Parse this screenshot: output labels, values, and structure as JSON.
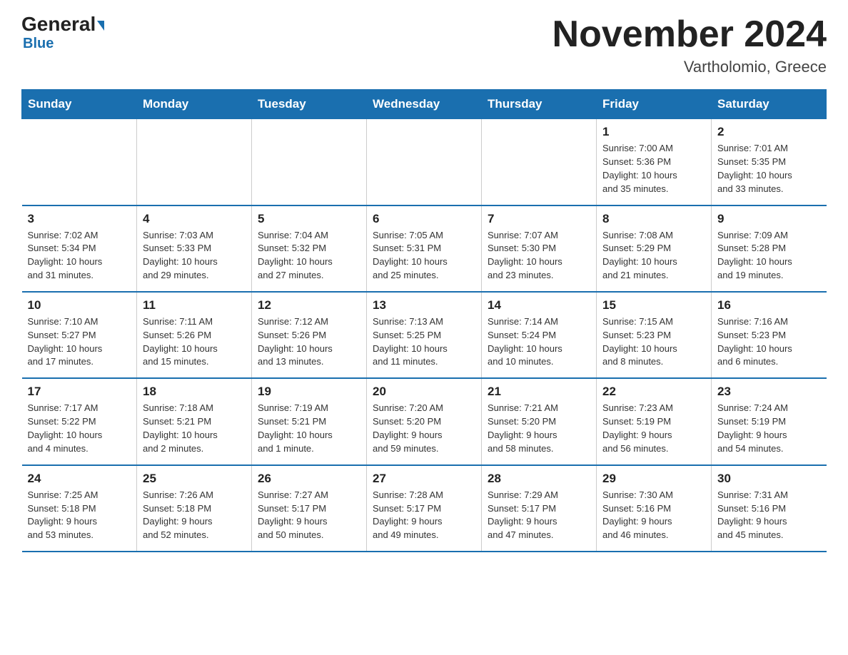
{
  "header": {
    "logo_line1a": "General",
    "logo_line1b": "Blue",
    "month_title": "November 2024",
    "subtitle": "Vartholomio, Greece"
  },
  "weekdays": [
    "Sunday",
    "Monday",
    "Tuesday",
    "Wednesday",
    "Thursday",
    "Friday",
    "Saturday"
  ],
  "rows": [
    [
      {
        "day": "",
        "info": ""
      },
      {
        "day": "",
        "info": ""
      },
      {
        "day": "",
        "info": ""
      },
      {
        "day": "",
        "info": ""
      },
      {
        "day": "",
        "info": ""
      },
      {
        "day": "1",
        "info": "Sunrise: 7:00 AM\nSunset: 5:36 PM\nDaylight: 10 hours\nand 35 minutes."
      },
      {
        "day": "2",
        "info": "Sunrise: 7:01 AM\nSunset: 5:35 PM\nDaylight: 10 hours\nand 33 minutes."
      }
    ],
    [
      {
        "day": "3",
        "info": "Sunrise: 7:02 AM\nSunset: 5:34 PM\nDaylight: 10 hours\nand 31 minutes."
      },
      {
        "day": "4",
        "info": "Sunrise: 7:03 AM\nSunset: 5:33 PM\nDaylight: 10 hours\nand 29 minutes."
      },
      {
        "day": "5",
        "info": "Sunrise: 7:04 AM\nSunset: 5:32 PM\nDaylight: 10 hours\nand 27 minutes."
      },
      {
        "day": "6",
        "info": "Sunrise: 7:05 AM\nSunset: 5:31 PM\nDaylight: 10 hours\nand 25 minutes."
      },
      {
        "day": "7",
        "info": "Sunrise: 7:07 AM\nSunset: 5:30 PM\nDaylight: 10 hours\nand 23 minutes."
      },
      {
        "day": "8",
        "info": "Sunrise: 7:08 AM\nSunset: 5:29 PM\nDaylight: 10 hours\nand 21 minutes."
      },
      {
        "day": "9",
        "info": "Sunrise: 7:09 AM\nSunset: 5:28 PM\nDaylight: 10 hours\nand 19 minutes."
      }
    ],
    [
      {
        "day": "10",
        "info": "Sunrise: 7:10 AM\nSunset: 5:27 PM\nDaylight: 10 hours\nand 17 minutes."
      },
      {
        "day": "11",
        "info": "Sunrise: 7:11 AM\nSunset: 5:26 PM\nDaylight: 10 hours\nand 15 minutes."
      },
      {
        "day": "12",
        "info": "Sunrise: 7:12 AM\nSunset: 5:26 PM\nDaylight: 10 hours\nand 13 minutes."
      },
      {
        "day": "13",
        "info": "Sunrise: 7:13 AM\nSunset: 5:25 PM\nDaylight: 10 hours\nand 11 minutes."
      },
      {
        "day": "14",
        "info": "Sunrise: 7:14 AM\nSunset: 5:24 PM\nDaylight: 10 hours\nand 10 minutes."
      },
      {
        "day": "15",
        "info": "Sunrise: 7:15 AM\nSunset: 5:23 PM\nDaylight: 10 hours\nand 8 minutes."
      },
      {
        "day": "16",
        "info": "Sunrise: 7:16 AM\nSunset: 5:23 PM\nDaylight: 10 hours\nand 6 minutes."
      }
    ],
    [
      {
        "day": "17",
        "info": "Sunrise: 7:17 AM\nSunset: 5:22 PM\nDaylight: 10 hours\nand 4 minutes."
      },
      {
        "day": "18",
        "info": "Sunrise: 7:18 AM\nSunset: 5:21 PM\nDaylight: 10 hours\nand 2 minutes."
      },
      {
        "day": "19",
        "info": "Sunrise: 7:19 AM\nSunset: 5:21 PM\nDaylight: 10 hours\nand 1 minute."
      },
      {
        "day": "20",
        "info": "Sunrise: 7:20 AM\nSunset: 5:20 PM\nDaylight: 9 hours\nand 59 minutes."
      },
      {
        "day": "21",
        "info": "Sunrise: 7:21 AM\nSunset: 5:20 PM\nDaylight: 9 hours\nand 58 minutes."
      },
      {
        "day": "22",
        "info": "Sunrise: 7:23 AM\nSunset: 5:19 PM\nDaylight: 9 hours\nand 56 minutes."
      },
      {
        "day": "23",
        "info": "Sunrise: 7:24 AM\nSunset: 5:19 PM\nDaylight: 9 hours\nand 54 minutes."
      }
    ],
    [
      {
        "day": "24",
        "info": "Sunrise: 7:25 AM\nSunset: 5:18 PM\nDaylight: 9 hours\nand 53 minutes."
      },
      {
        "day": "25",
        "info": "Sunrise: 7:26 AM\nSunset: 5:18 PM\nDaylight: 9 hours\nand 52 minutes."
      },
      {
        "day": "26",
        "info": "Sunrise: 7:27 AM\nSunset: 5:17 PM\nDaylight: 9 hours\nand 50 minutes."
      },
      {
        "day": "27",
        "info": "Sunrise: 7:28 AM\nSunset: 5:17 PM\nDaylight: 9 hours\nand 49 minutes."
      },
      {
        "day": "28",
        "info": "Sunrise: 7:29 AM\nSunset: 5:17 PM\nDaylight: 9 hours\nand 47 minutes."
      },
      {
        "day": "29",
        "info": "Sunrise: 7:30 AM\nSunset: 5:16 PM\nDaylight: 9 hours\nand 46 minutes."
      },
      {
        "day": "30",
        "info": "Sunrise: 7:31 AM\nSunset: 5:16 PM\nDaylight: 9 hours\nand 45 minutes."
      }
    ]
  ]
}
